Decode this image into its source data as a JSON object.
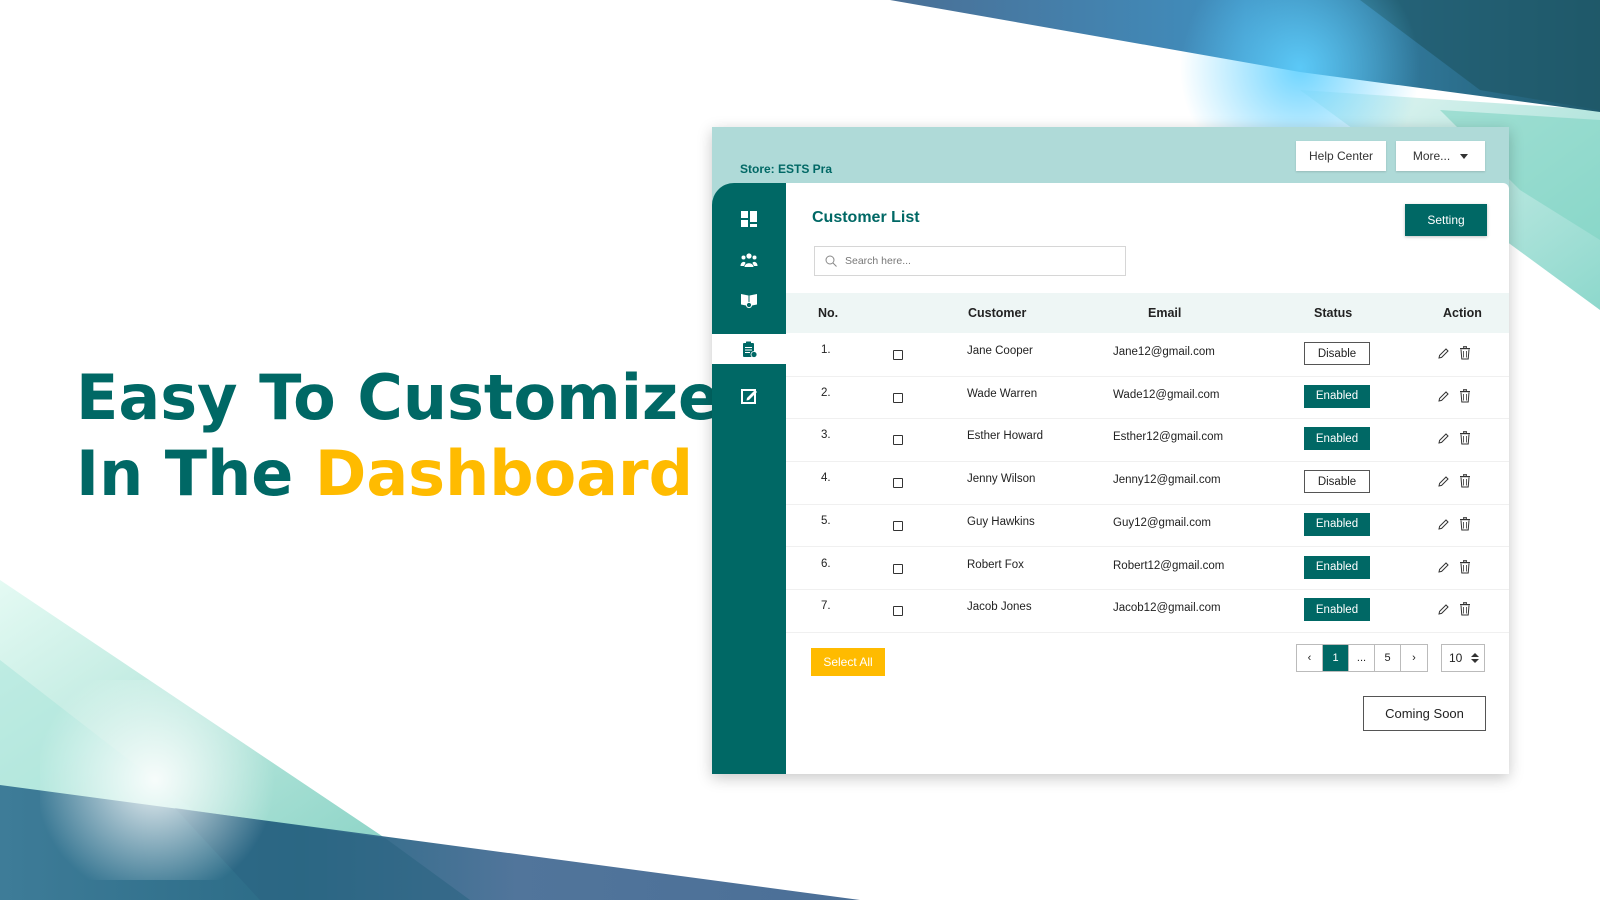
{
  "hero": {
    "line1": "Easy To Customize",
    "line2_prefix": "In The ",
    "line2_accent": "Dashboard"
  },
  "colors": {
    "primary": "#006865",
    "accent": "#FFBB00",
    "topbar": "#afdad8"
  },
  "topbar": {
    "store_label": "Store: ESTS Pra",
    "help_center": "Help Center",
    "more": "More..."
  },
  "sidebar": {
    "items": [
      {
        "icon": "dashboard-icon",
        "active": false
      },
      {
        "icon": "users-icon",
        "active": false
      },
      {
        "icon": "book-icon",
        "active": false
      },
      {
        "icon": "clipboard-list-icon",
        "active": true
      },
      {
        "icon": "edit-icon",
        "active": false
      }
    ]
  },
  "main": {
    "title": "Customer List",
    "setting_button": "Setting",
    "search_placeholder": "Search here...",
    "columns": [
      "No.",
      "",
      "Customer",
      "Email",
      "Status",
      "Action"
    ],
    "rows": [
      {
        "no": "1.",
        "name": "Jane Cooper",
        "email": "Jane12@gmail.com",
        "status": "Disable"
      },
      {
        "no": "2.",
        "name": "Wade Warren",
        "email": "Wade12@gmail.com",
        "status": "Enabled"
      },
      {
        "no": "3.",
        "name": "Esther Howard",
        "email": "Esther12@gmail.com",
        "status": "Enabled"
      },
      {
        "no": "4.",
        "name": "Jenny Wilson",
        "email": "Jenny12@gmail.com",
        "status": "Disable"
      },
      {
        "no": "5.",
        "name": "Guy Hawkins",
        "email": "Guy12@gmail.com",
        "status": "Enabled"
      },
      {
        "no": "6.",
        "name": "Robert Fox",
        "email": "Robert12@gmail.com",
        "status": "Enabled"
      },
      {
        "no": "7.",
        "name": "Jacob Jones",
        "email": "Jacob12@gmail.com",
        "status": "Enabled"
      }
    ],
    "select_all": "Select All",
    "pagination": {
      "prev": "‹",
      "pages": [
        "1",
        "...",
        "5"
      ],
      "current": "1",
      "next": "›"
    },
    "page_size": "10",
    "coming_soon": "Coming Soon"
  }
}
